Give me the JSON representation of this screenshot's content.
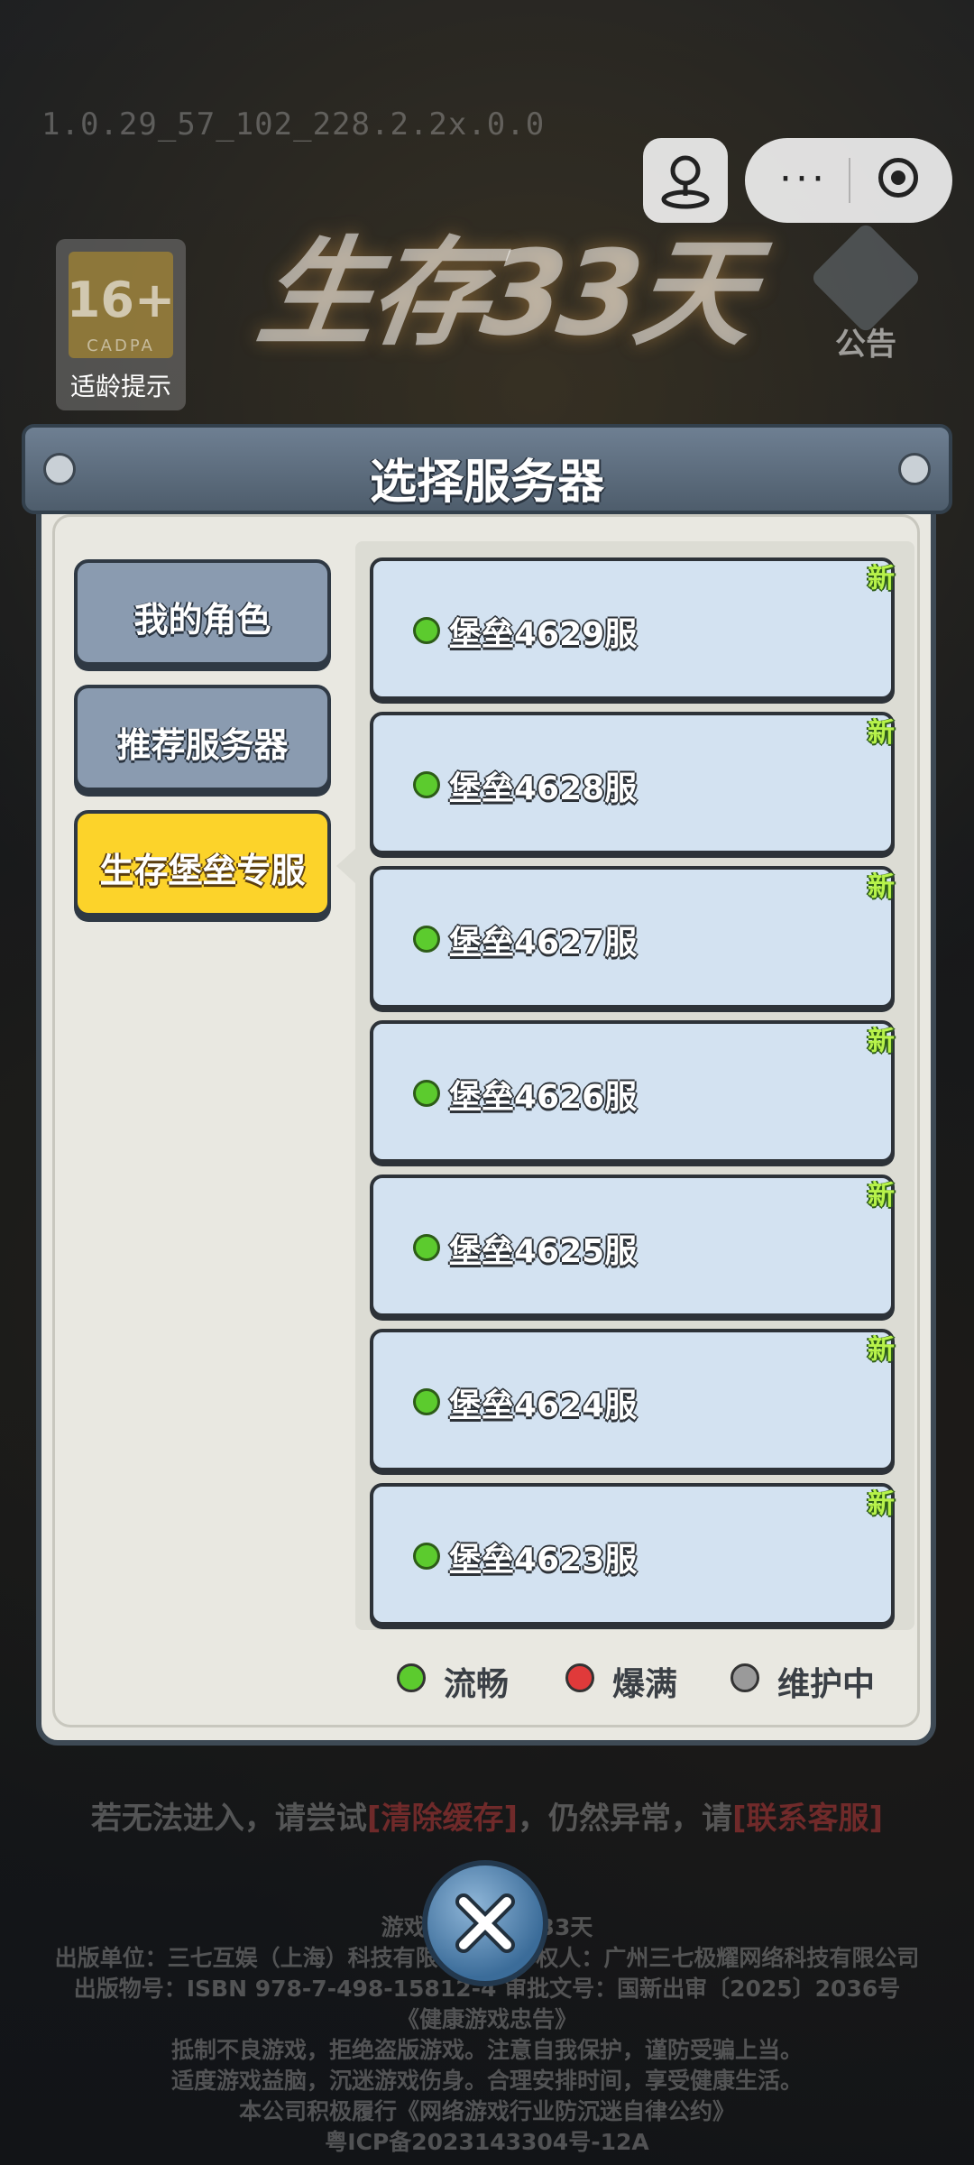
{
  "version": "1.0.29_57_102_228.2.2x.0.0",
  "age_badge": {
    "rating": "16+",
    "org": "CADPA",
    "caption": "适龄提示"
  },
  "logo_text": "生存33天",
  "notice": {
    "label": "公告"
  },
  "dialog": {
    "title": "选择服务器",
    "tabs": [
      {
        "label": "我的角色"
      },
      {
        "label": "推荐服务器"
      },
      {
        "label": "生存堡垒专服"
      }
    ],
    "servers": [
      {
        "name": "堡垒4629服",
        "badge": "新"
      },
      {
        "name": "堡垒4628服",
        "badge": "新"
      },
      {
        "name": "堡垒4627服",
        "badge": "新"
      },
      {
        "name": "堡垒4626服",
        "badge": "新"
      },
      {
        "name": "堡垒4625服",
        "badge": "新"
      },
      {
        "name": "堡垒4624服",
        "badge": "新"
      },
      {
        "name": "堡垒4623服",
        "badge": "新"
      }
    ],
    "legend": [
      {
        "label": "流畅",
        "color": "#5ccb2e"
      },
      {
        "label": "爆满",
        "color": "#e03a3a"
      },
      {
        "label": "维护中",
        "color": "#9a9a9a"
      }
    ]
  },
  "help": {
    "prefix": "若无法进入，请尝试",
    "clear_cache": "[清除缓存]",
    "middle": "，仍然异常，请",
    "contact": "[联系客服]"
  },
  "footer": [
    "游戏名称：生存33天",
    "出版单位：三七互娱（上海）科技有限公司  著作权人：广州三七极耀网络科技有限公司",
    "出版物号：ISBN 978-7-498-15812-4  审批文号：国新出审〔2025〕2036号",
    "《健康游戏忠告》",
    "抵制不良游戏，拒绝盗版游戏。注意自我保护，谨防受骗上当。",
    "适度游戏益脑，沉迷游戏伤身。合理安排时间，享受健康生活。",
    "本公司积极履行《网络游戏行业防沉迷自律公约》",
    "粤ICP备2023143304号-12A"
  ]
}
